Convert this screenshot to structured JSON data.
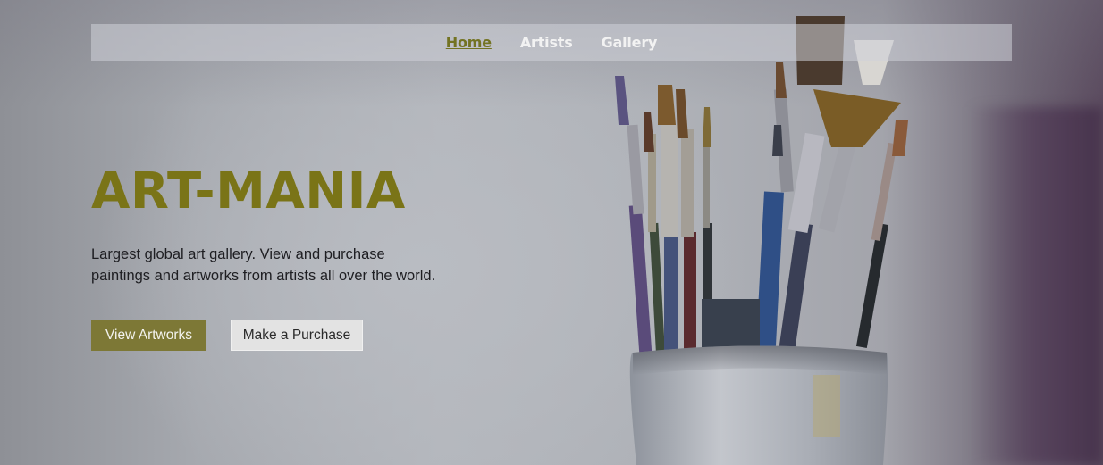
{
  "nav": {
    "items": [
      {
        "label": "Home",
        "active": true
      },
      {
        "label": "Artists",
        "active": false
      },
      {
        "label": "Gallery",
        "active": false
      }
    ]
  },
  "hero": {
    "title": "ART-MANIA",
    "description": "Largest global art gallery. View and purchase paintings and artworks from artists all over the world.",
    "primary_button": "View Artworks",
    "secondary_button": "Make a Purchase",
    "image": "paintbrushes-in-cup"
  },
  "colors": {
    "accent": "#7a7417",
    "primary_button_bg": "#7d7836",
    "secondary_button_bg": "#e3e3e3",
    "nav_active": "#737322",
    "nav_text": "#f2f2f2"
  }
}
